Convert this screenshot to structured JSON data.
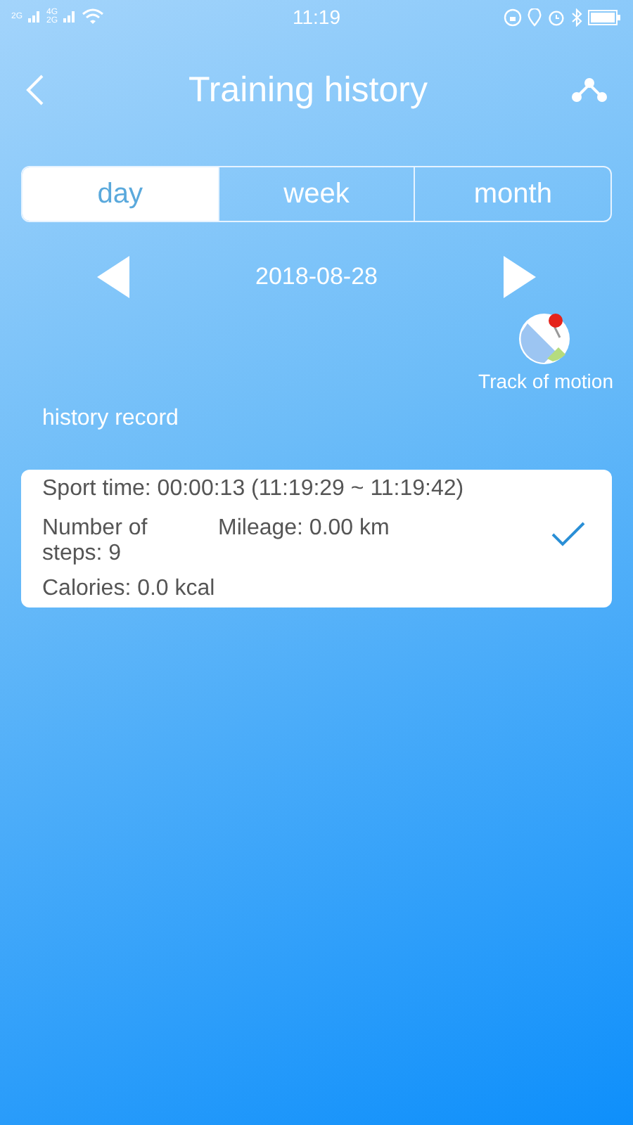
{
  "status_bar": {
    "network_labels": [
      "2G",
      "4G",
      "2G"
    ],
    "time": "11:19"
  },
  "header": {
    "title": "Training history"
  },
  "tabs": [
    {
      "label": "day",
      "selected": true
    },
    {
      "label": "week",
      "selected": false
    },
    {
      "label": "month",
      "selected": false
    }
  ],
  "date": "2018-08-28",
  "track_button": {
    "label": "Track of motion"
  },
  "section_title": "history record",
  "records": [
    {
      "sport_time": "Sport time:  00:00:13 (11:19:29 ~ 11:19:42)",
      "steps": "Number of steps:   9",
      "mileage": "Mileage: 0.00 km",
      "calories": "Calories: 0.0 kcal",
      "checked": true
    }
  ]
}
